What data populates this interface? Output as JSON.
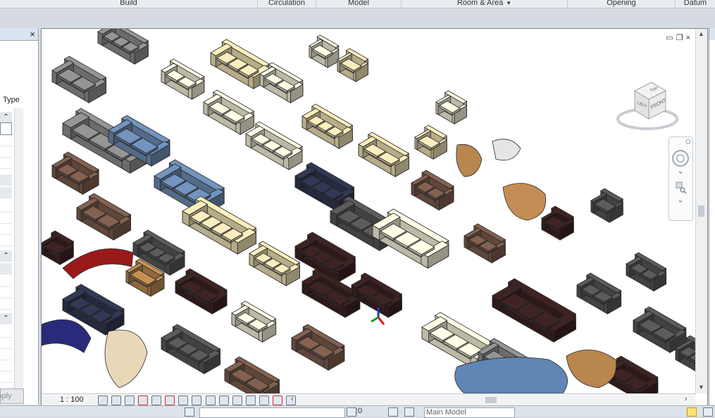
{
  "ribbon": {
    "panels": [
      {
        "label": "Build",
        "has_dropdown": false
      },
      {
        "label": "Circulation",
        "has_dropdown": false
      },
      {
        "label": "Model",
        "has_dropdown": false
      },
      {
        "label": "Room & Area",
        "has_dropdown": true
      },
      {
        "label": "Opening",
        "has_dropdown": false
      },
      {
        "label": "Datum",
        "has_dropdown": false
      }
    ]
  },
  "properties": {
    "close_glyph": "×",
    "type_label": "Type",
    "apply_label": "Apply",
    "group_collapse_glyph": "⌃"
  },
  "view": {
    "window_controls": {
      "minimize": "▭",
      "restore": "❐",
      "close": "×"
    },
    "scale": "1 : 100",
    "viewcube": {
      "top": "TOP",
      "front": "FRONT",
      "left": "LEFT"
    },
    "scroll_left": "‹",
    "scroll_right": "›"
  },
  "status": {
    "selection_count": ":0",
    "active_model": "Main Model"
  },
  "colors": {
    "accent": "#3c7ac3",
    "ribbon_bg": "#e9ecf0",
    "panel_header": "#d9e4f1"
  },
  "furniture_palette": [
    "#8a8a8a",
    "#e8dcb0",
    "#7a5a4a",
    "#2e3550",
    "#6a89b0",
    "#9a1a1a",
    "#3b2020",
    "#b8864e",
    "#f2ecd6",
    "#555555"
  ]
}
